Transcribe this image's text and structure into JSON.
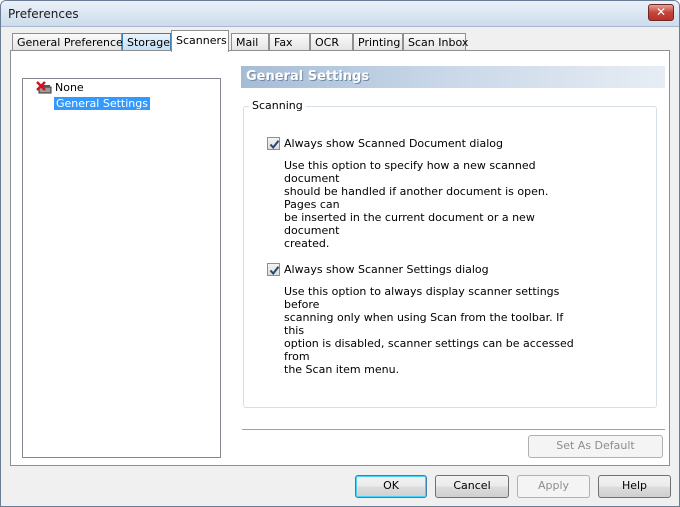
{
  "window": {
    "title": "Preferences",
    "close_label": "✕"
  },
  "tabs": [
    {
      "label": "General Preferences"
    },
    {
      "label": "Storage"
    },
    {
      "label": "Scanners"
    },
    {
      "label": "Mail"
    },
    {
      "label": "Fax"
    },
    {
      "label": "OCR"
    },
    {
      "label": "Printing"
    },
    {
      "label": "Scan Inbox"
    }
  ],
  "active_tab": "Scanners",
  "tree": {
    "items": [
      {
        "label": "None",
        "icon": "scanner-none-icon"
      },
      {
        "label": "General Settings",
        "selected": true
      }
    ]
  },
  "panel": {
    "header": "General Settings",
    "group_label": "Scanning",
    "options": [
      {
        "label": "Always show Scanned Document dialog",
        "checked": true,
        "description": "Use this option to specify how a new scanned document\nshould be handled if another document is open.  Pages can\nbe inserted in the current document or a new document\ncreated."
      },
      {
        "label": "Always show Scanner Settings dialog",
        "checked": true,
        "description": "Use this option to always display scanner settings before\nscanning only when using Scan from the toolbar.  If this\noption is disabled, scanner settings can be accessed from\nthe Scan item menu."
      }
    ],
    "set_default_label": "Set As Default"
  },
  "buttons": {
    "ok": "OK",
    "cancel": "Cancel",
    "apply": "Apply",
    "help": "Help"
  },
  "colors": {
    "selection": "#3399ff",
    "header_gradient_start": "#a6bcd5",
    "close_button": "#c7443a"
  }
}
